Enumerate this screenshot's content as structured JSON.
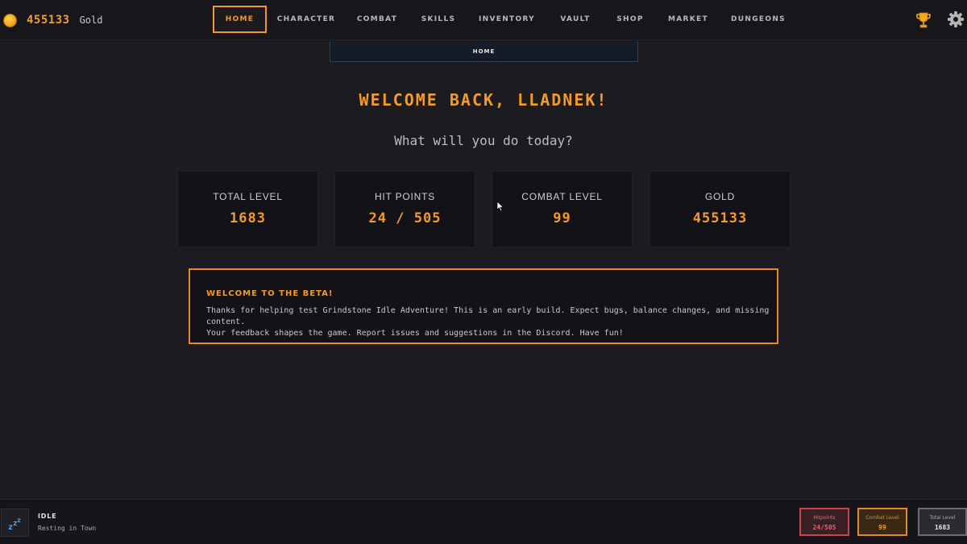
{
  "header": {
    "gold_amount": "455133",
    "gold_unit": "Gold",
    "coin_icon": "gold-coin-icon",
    "nav": [
      {
        "label": "HOME",
        "active": true
      },
      {
        "label": "CHARACTER",
        "active": false
      },
      {
        "label": "COMBAT",
        "active": false
      },
      {
        "label": "SKILLS",
        "active": false
      },
      {
        "label": "INVENTORY",
        "active": false
      },
      {
        "label": "VAULT",
        "active": false
      },
      {
        "label": "SHOP",
        "active": false
      },
      {
        "label": "MARKET",
        "active": false
      },
      {
        "label": "DUNGEONS",
        "active": false
      }
    ],
    "right_icons": [
      "trophy-icon",
      "gear-icon"
    ]
  },
  "breadcrumb": "HOME",
  "main": {
    "title": "WELCOME BACK, LLADNEK!",
    "subtitle": "What will you do today?",
    "stats": [
      {
        "label": "TOTAL LEVEL",
        "value": "1683"
      },
      {
        "label": "HIT POINTS",
        "value": "24 / 505"
      },
      {
        "label": "COMBAT LEVEL",
        "value": "99"
      },
      {
        "label": "GOLD",
        "value": "455133"
      }
    ],
    "beta": {
      "title": "WELCOME TO THE BETA!",
      "line1": "Thanks for helping test Grindstone Idle Adventure! This is an early build. Expect bugs, balance changes, and missing content.",
      "line2": "Your feedback shapes the game. Report issues and suggestions in the Discord. Have fun!"
    }
  },
  "footer": {
    "activity_title": "IDLE",
    "activity_sub": "Resting in Town",
    "activity_icon": "sleep-zzz-icon",
    "mini_stats": [
      {
        "label": "Hitpoints",
        "value": "24/505"
      },
      {
        "label": "Combat Level",
        "value": "99"
      },
      {
        "label": "Total Level",
        "value": "1683"
      }
    ]
  },
  "colors": {
    "accent": "#f39a2b",
    "background": "#1c1b20",
    "card": "#131317",
    "hp": "#c8454d",
    "zzz": "#4aa8ff"
  }
}
